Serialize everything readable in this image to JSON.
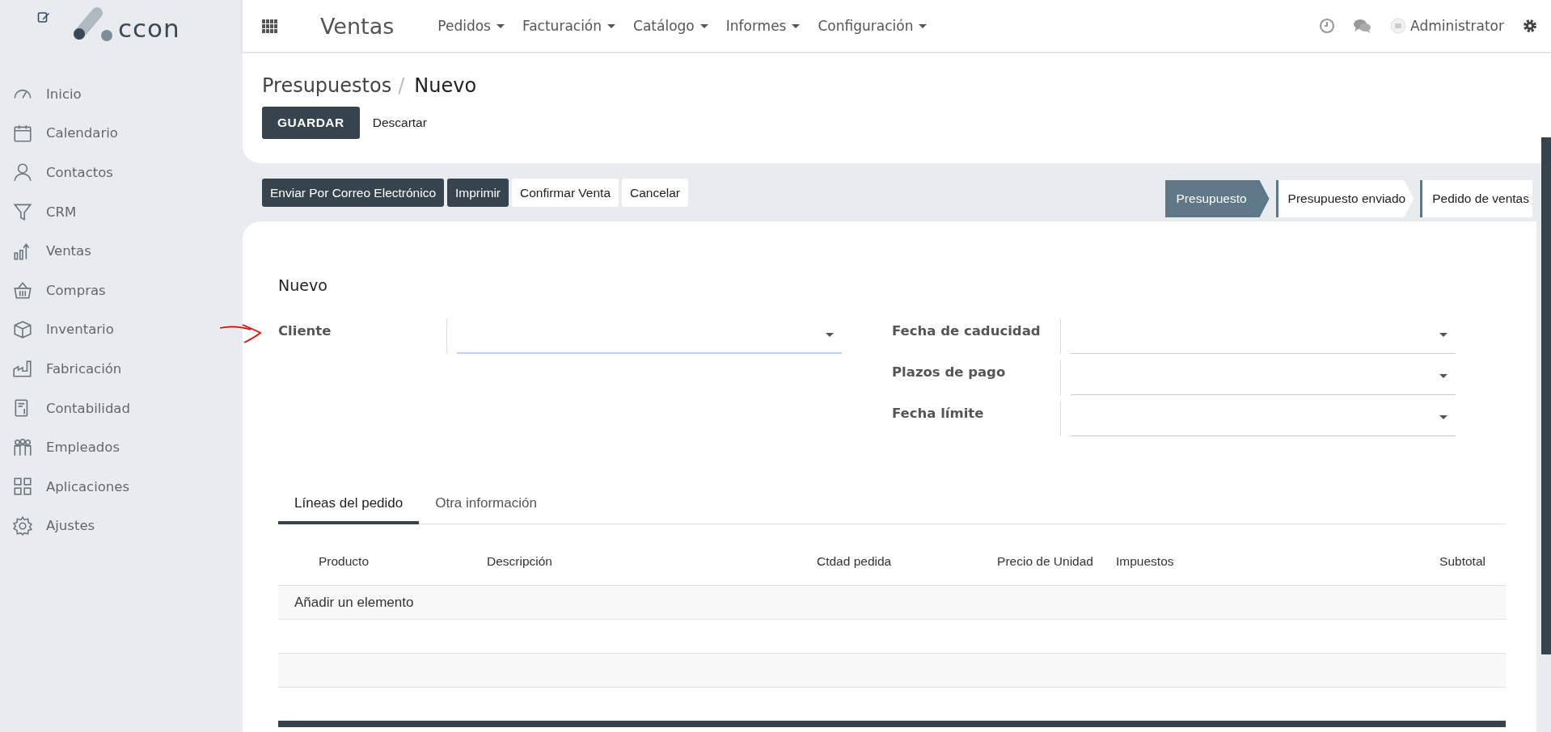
{
  "logo": {
    "text": "ccon"
  },
  "sidebar": {
    "items": [
      {
        "label": "Inicio"
      },
      {
        "label": "Calendario"
      },
      {
        "label": "Contactos"
      },
      {
        "label": "CRM"
      },
      {
        "label": "Ventas"
      },
      {
        "label": "Compras"
      },
      {
        "label": "Inventario"
      },
      {
        "label": "Fabricación"
      },
      {
        "label": "Contabilidad"
      },
      {
        "label": "Empleados"
      },
      {
        "label": "Aplicaciones"
      },
      {
        "label": "Ajustes"
      }
    ]
  },
  "topbar": {
    "app_title": "Ventas",
    "menus": [
      "Pedidos",
      "Facturación",
      "Catálogo",
      "Informes",
      "Configuración"
    ],
    "user": "Administrator"
  },
  "breadcrumb": {
    "parent": "Presupuestos",
    "separator": "/",
    "current": "Nuevo"
  },
  "control_buttons": [
    {
      "label": "GUARDAR",
      "kind": "primary"
    },
    {
      "label": "Descartar",
      "kind": "link"
    }
  ],
  "action_buttons": [
    {
      "label": "Enviar Por Correo Electrónico",
      "kind": "primary"
    },
    {
      "label": "Imprimir",
      "kind": "primary"
    },
    {
      "label": "Confirmar Venta",
      "kind": "secondary"
    },
    {
      "label": "Cancelar",
      "kind": "secondary"
    }
  ],
  "status_steps": [
    {
      "label": "Presupuesto",
      "selected": true
    },
    {
      "label": "Presupuesto enviado",
      "selected": false
    },
    {
      "label": "Pedido de ventas",
      "selected": false
    }
  ],
  "form": {
    "title": "Nuevo",
    "left_fields": [
      {
        "label": "Cliente",
        "focused": true
      }
    ],
    "right_fields": [
      {
        "label": "Fecha de caducidad",
        "focused": false
      },
      {
        "label": "Plazos de pago",
        "focused": false
      },
      {
        "label": "Fecha límite",
        "focused": false
      }
    ]
  },
  "tabs": [
    {
      "label": "Líneas del pedido",
      "selected": true
    },
    {
      "label": "Otra información",
      "selected": false
    }
  ],
  "table": {
    "columns": [
      "Producto",
      "Descripción",
      "Ctdad pedida",
      "Precio de Unidad",
      "Impuestos",
      "Subtotal"
    ],
    "add_line": "Añadir un elemento"
  }
}
